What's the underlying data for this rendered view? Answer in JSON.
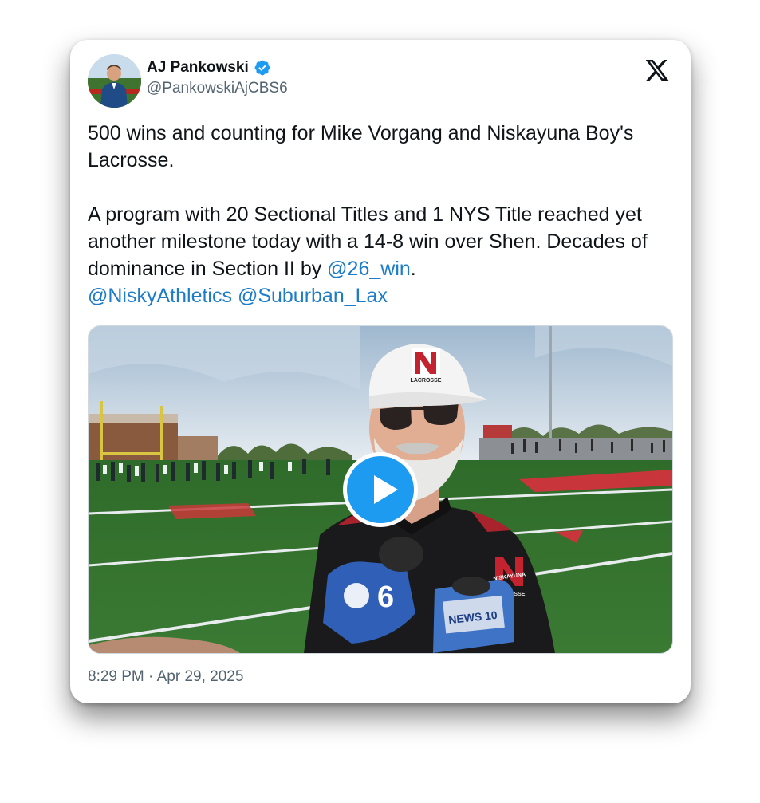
{
  "author": {
    "display_name": "AJ Pankowski",
    "handle": "@PankowskiAjCBS6",
    "verified": true,
    "avatar_icon": "avatar-photo"
  },
  "tweet": {
    "paragraph1": "500 wins and counting for Mike Vorgang and Niskayuna Boy's Lacrosse.",
    "paragraph2_text": "A program with 20 Sectional Titles and 1 NYS Title reached yet another milestone today with a 14-8 win over Shen. Decades of dominance in Section II by ",
    "mention1": "@26_win",
    "after_mention1": ".",
    "mention2": "@NiskyAthletics",
    "mention3": "@Suburban_Lax"
  },
  "media": {
    "type": "video",
    "play_icon": "play-icon",
    "cap_logo_text": "LACROSSE",
    "shirt_logo_text": "NISKAYUNA",
    "shirt_logo_sub": "LACROSSE",
    "mic1_text": "6",
    "mic2_text": "NEWS 10"
  },
  "timestamp": "8:29 PM · Apr 29, 2025",
  "colors": {
    "link": "#1d7cc8",
    "verified": "#1d9bf0",
    "secondary_text": "#536471"
  },
  "x_logo_icon": "x-logo-icon"
}
